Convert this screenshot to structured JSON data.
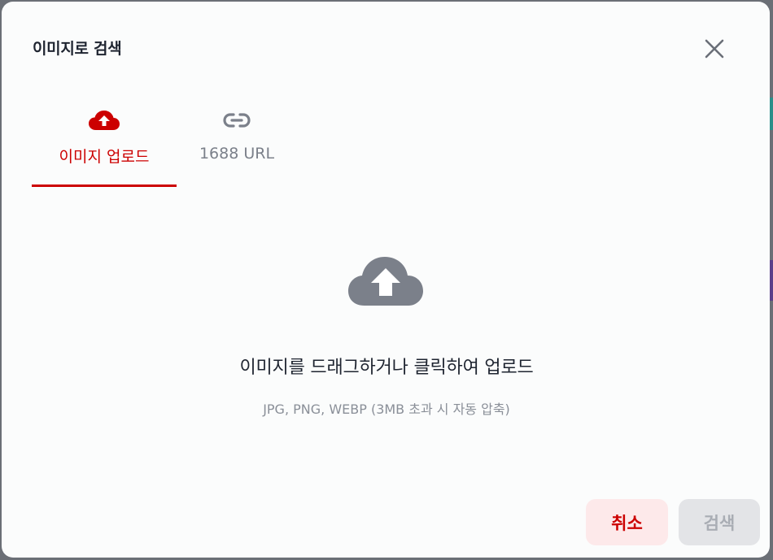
{
  "dialog": {
    "title": "이미지로 검색",
    "close_icon": "close-icon"
  },
  "tabs": [
    {
      "label": "이미지 업로드",
      "icon": "cloud-upload-icon",
      "active": true
    },
    {
      "label": "1688 URL",
      "icon": "link-icon",
      "active": false
    }
  ],
  "dropzone": {
    "icon": "cloud-upload-icon",
    "main_text": "이미지를 드래그하거나 클릭하여 업로드",
    "sub_text": "JPG, PNG, WEBP (3MB 초과 시 자동 압축)"
  },
  "buttons": {
    "cancel_label": "취소",
    "search_label": "검색"
  },
  "colors": {
    "accent": "#cc0000",
    "accent_bg": "#fde9ea",
    "disabled_bg": "#e3e4e7",
    "icon_gray": "#7b808a"
  }
}
